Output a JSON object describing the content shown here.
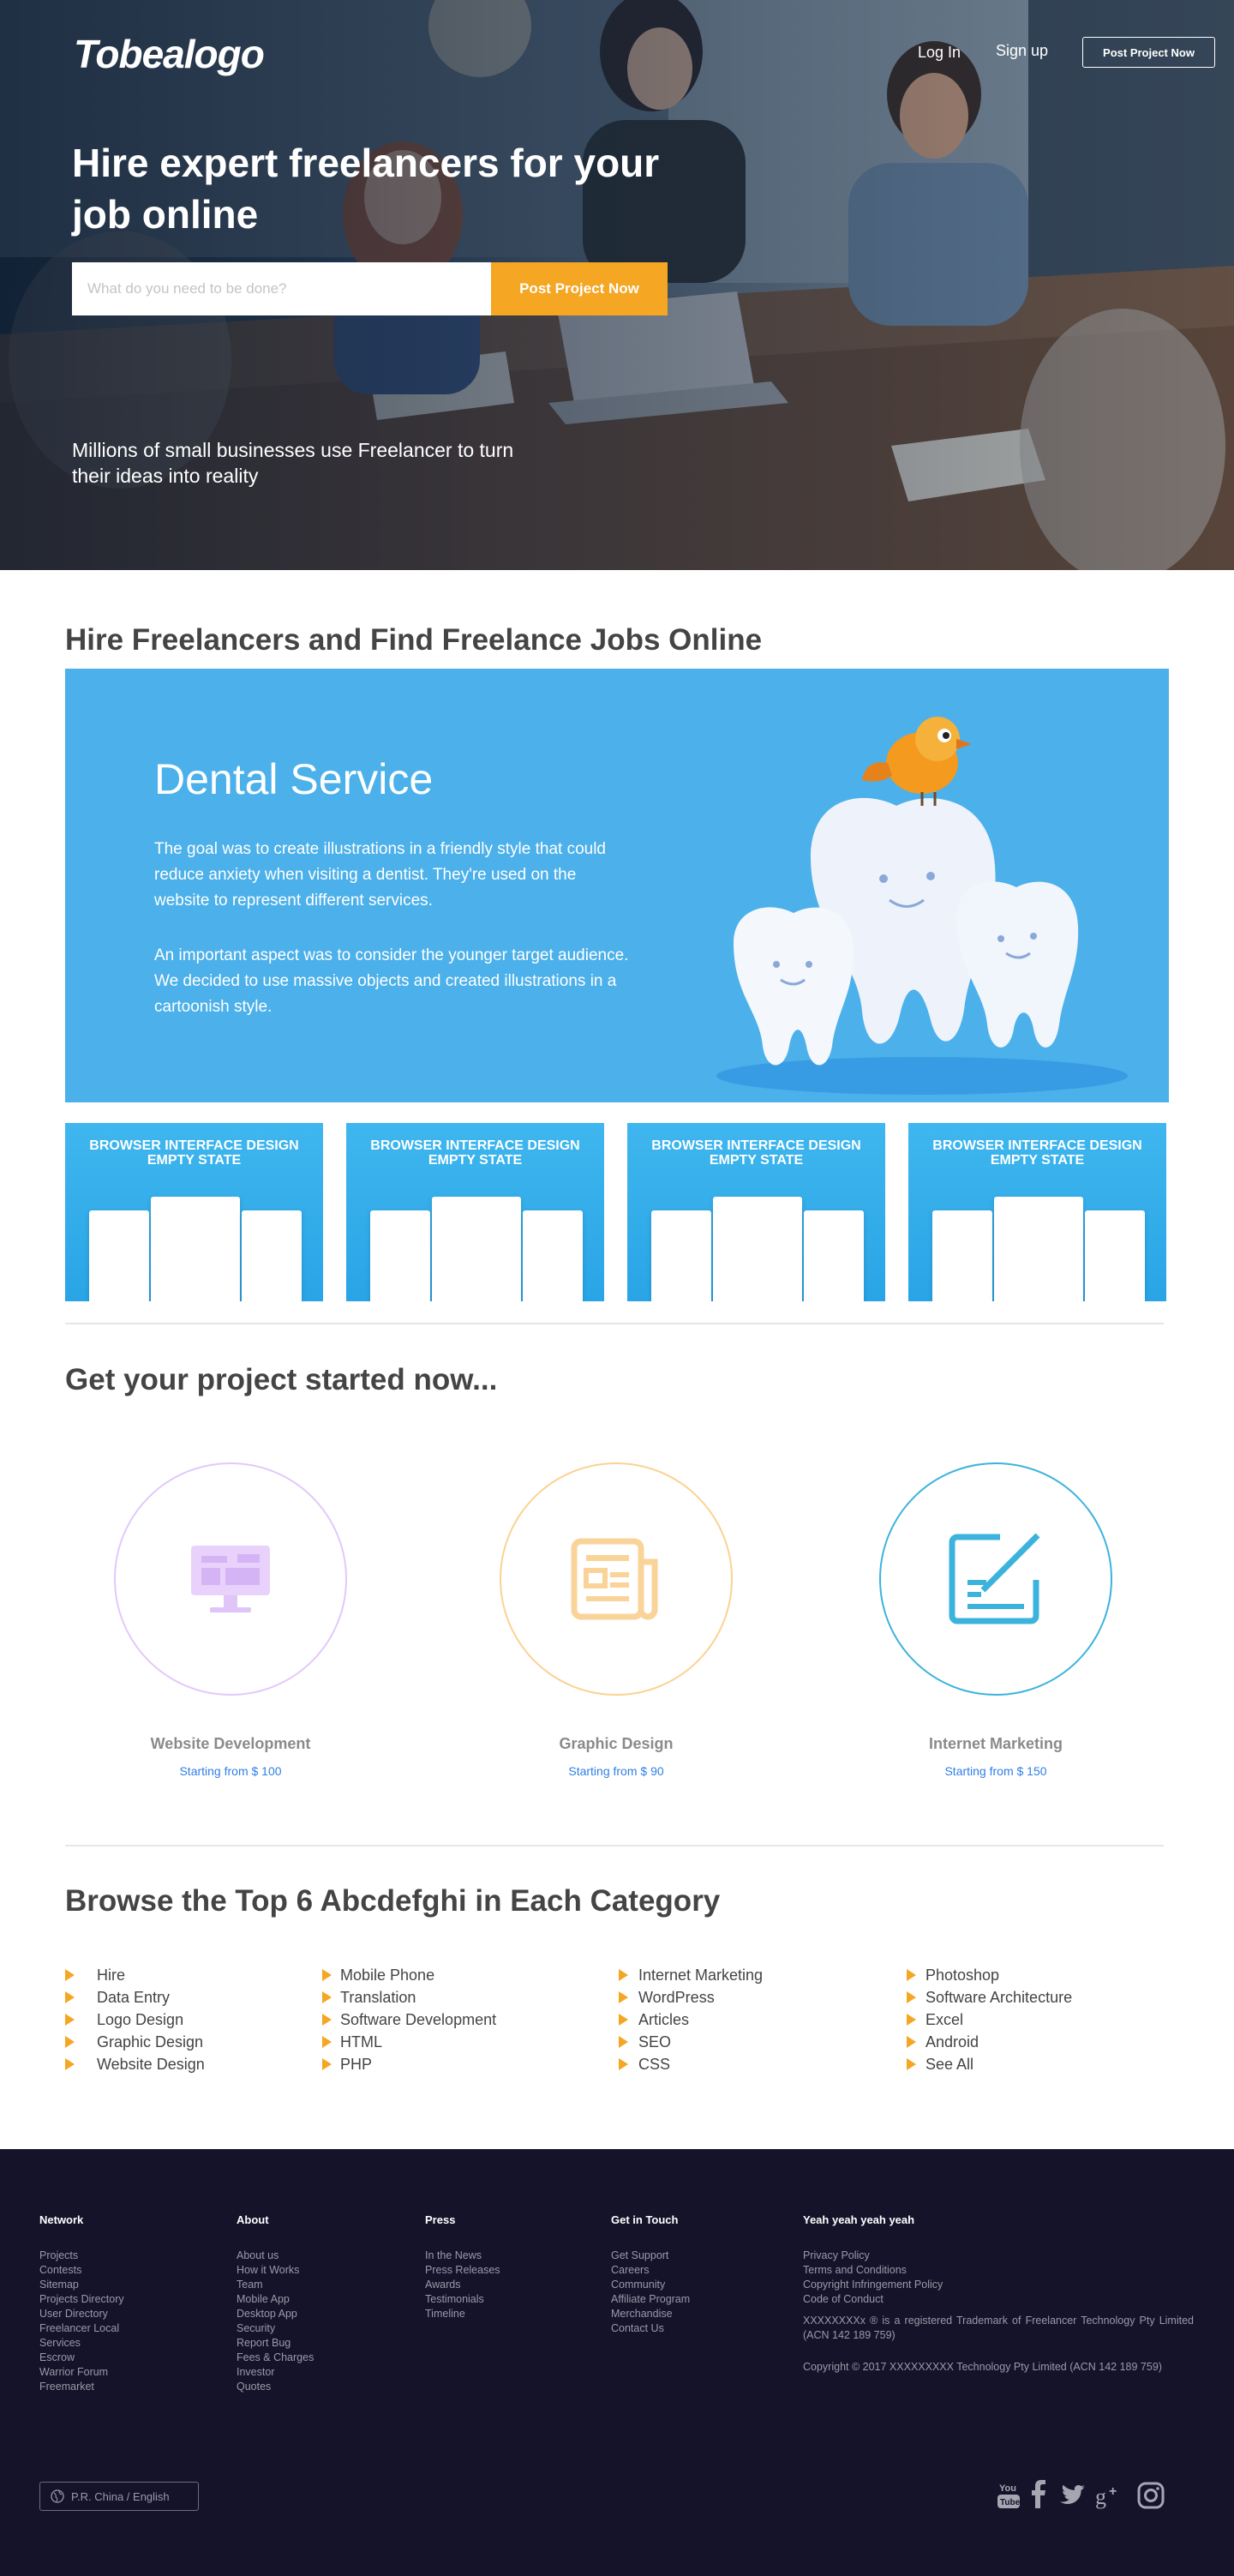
{
  "header": {
    "logo": "Tobealogo",
    "login": "Log In",
    "signup": "Sign up",
    "post_project": "Post Project Now"
  },
  "hero": {
    "title": "Hire expert freelancers for your job online",
    "search_placeholder": "What do you need to be done?",
    "search_button": "Post Project Now",
    "subtitle": "Millions of small businesses use Freelancer to turn their ideas into reality"
  },
  "showcase": {
    "title": "Hire Freelancers and Find Freelance Jobs Online",
    "banner": {
      "heading": "Dental Service",
      "para1": "The goal was to create illustrations in a friendly style that could reduce anxiety when visiting a dentist. They're used on the website to represent different services.",
      "para2": "An important aspect was to consider the younger target audience. We decided to use massive objects and created illustrations in a cartoonish style."
    },
    "thumbnails": [
      {
        "title": "BROWSER INTERFACE DESIGN EMPTY STATE"
      },
      {
        "title": "BROWSER INTERFACE DESIGN EMPTY STATE"
      },
      {
        "title": "BROWSER INTERFACE DESIGN EMPTY STATE"
      },
      {
        "title": "BROWSER INTERFACE DESIGN EMPTY STATE"
      }
    ]
  },
  "start": {
    "title": "Get your project started now...",
    "services": [
      {
        "name": "Website Development",
        "price": "Starting from $ 100",
        "icon": "monitor-icon",
        "color": "#d9b8f5"
      },
      {
        "name": "Graphic Design",
        "price": "Starting from $ 90",
        "icon": "newspaper-icon",
        "color": "#f9c57a"
      },
      {
        "name": "Internet Marketing",
        "price": "Starting from $ 150",
        "icon": "edit-icon",
        "color": "#3cb3dc"
      }
    ]
  },
  "categories": {
    "title": "Browse the Top 6 Abcdefghi  in Each Category",
    "columns": [
      [
        "Hire",
        "Data Entry",
        "Logo Design",
        "Graphic Design",
        "Website Design"
      ],
      [
        "Mobile Phone",
        "Translation",
        "Software Development",
        "HTML",
        "PHP"
      ],
      [
        "Internet Marketing",
        "WordPress",
        "Articles",
        "SEO",
        "CSS"
      ],
      [
        "Photoshop",
        "Software Architecture",
        "Excel",
        "Android",
        "See All"
      ]
    ]
  },
  "footer": {
    "columns": [
      {
        "title": "Network",
        "links": [
          "Projects",
          "Contests",
          "Sitemap",
          "Projects Directory",
          "User Directory",
          "Freelancer Local",
          "Services",
          "Escrow",
          "Warrior Forum",
          "Freemarket"
        ]
      },
      {
        "title": "About",
        "links": [
          "About us",
          "How it Works",
          "Team",
          "Mobile App",
          "Desktop App",
          "Security",
          "Report Bug",
          "Fees & Charges",
          "Investor",
          "Quotes"
        ]
      },
      {
        "title": "Press",
        "links": [
          "In the News",
          "Press Releases",
          "Awards",
          "Testimonials",
          "Timeline"
        ]
      },
      {
        "title": "Get in Touch",
        "links": [
          "Get Support",
          "Careers",
          "Community",
          "Affiliate Program",
          "Merchandise",
          "Contact Us"
        ]
      },
      {
        "title": "Yeah yeah yeah yeah",
        "links": [
          "Privacy Policy",
          "Terms and Conditions",
          "Copyright Infringement Policy",
          "Code of Conduct"
        ]
      }
    ],
    "trademark": "XXXXXXXXx ® is a registered Trademark of Freelancer Technology Pty Limited (ACN 142 189 759)",
    "copyright": "Copyright © 2017 XXXXXXXXX Technology Pty Limited (ACN 142 189 759)",
    "language": "P.R. China / English",
    "social": [
      "youtube-icon",
      "facebook-icon",
      "twitter-icon",
      "google-plus-icon",
      "instagram-icon"
    ]
  }
}
